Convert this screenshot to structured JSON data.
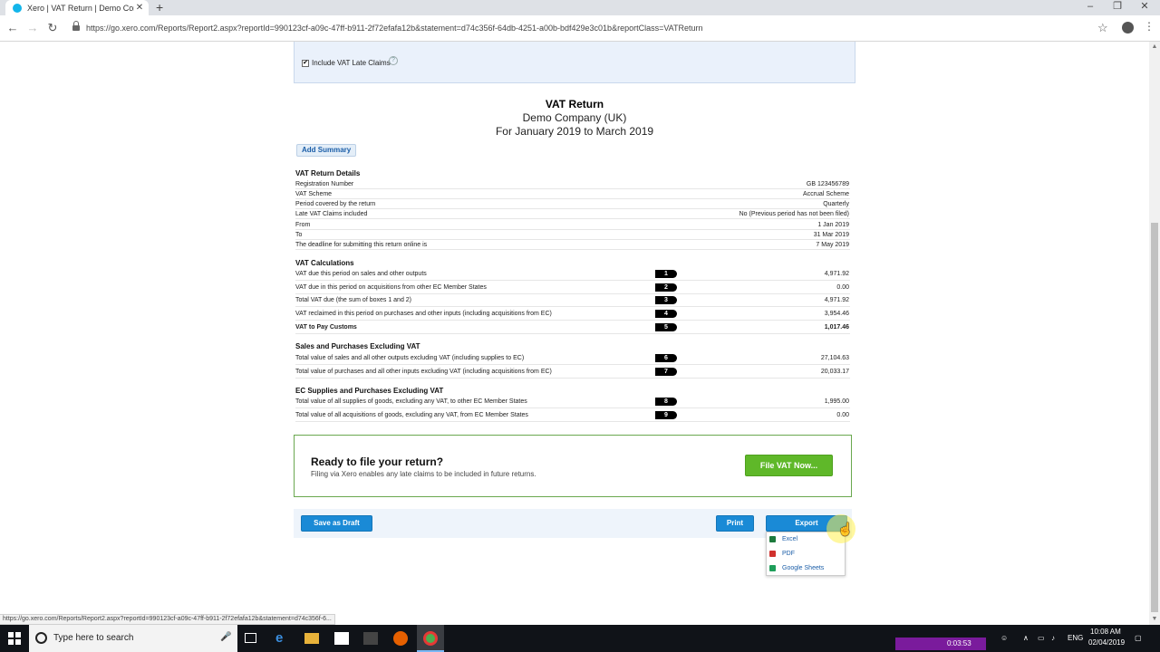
{
  "browser": {
    "tab_title": "Xero | VAT Return | Demo Compa",
    "new_tab": "+",
    "url": "https://go.xero.com/Reports/Report2.aspx?reportId=990123cf-a09c-47ff-b911-2f72efafa12b&statement=d74c356f-64db-4251-a00b-bdf429e3c01b&reportClass=VATReturn",
    "status_url": "https://go.xero.com/Reports/Report2.aspx?reportId=990123cf-a09c-47ff-b911-2f72efafa12b&statement=d74c356f-6..."
  },
  "options": {
    "include_late_claims_label": "Include VAT Late Claims",
    "include_late_claims_checked": true
  },
  "report": {
    "title": "VAT Return",
    "company": "Demo Company (UK)",
    "period": "For January 2019 to March 2019",
    "add_summary_label": "Add Summary"
  },
  "details": {
    "heading": "VAT Return Details",
    "rows": [
      {
        "label": "Registration Number",
        "value": "GB 123456789"
      },
      {
        "label": "VAT Scheme",
        "value": "Accrual Scheme"
      },
      {
        "label": "Period covered by the return",
        "value": "Quarterly"
      },
      {
        "label": "Late VAT Claims included",
        "value": "No (Previous period has not been filed)"
      },
      {
        "label": "From",
        "value": "1 Jan 2019"
      },
      {
        "label": "To",
        "value": "31 Mar 2019"
      },
      {
        "label": "The deadline for submitting this return online is",
        "value": "7 May 2019"
      }
    ]
  },
  "calculations": {
    "heading": "VAT Calculations",
    "rows": [
      {
        "label": "VAT due this period on sales and other outputs",
        "box": "1",
        "value": "4,971.92"
      },
      {
        "label": "VAT due in this period on acquisitions from other EC Member States",
        "box": "2",
        "value": "0.00"
      },
      {
        "label": "Total VAT due (the sum of boxes 1 and 2)",
        "box": "3",
        "value": "4,971.92"
      },
      {
        "label": "VAT reclaimed in this period on purchases and other inputs (including acquisitions from EC)",
        "box": "4",
        "value": "3,954.46"
      },
      {
        "label": "VAT to Pay Customs",
        "box": "5",
        "value": "1,017.46"
      }
    ]
  },
  "sales_purchases": {
    "heading": "Sales and Purchases Excluding VAT",
    "rows": [
      {
        "label": "Total value of sales and all other outputs excluding VAT (including supplies to EC)",
        "box": "6",
        "value": "27,104.63"
      },
      {
        "label": "Total value of purchases and all other inputs excluding VAT (including acquisitions from EC)",
        "box": "7",
        "value": "20,033.17"
      }
    ]
  },
  "ec_supplies": {
    "heading": "EC Supplies and Purchases Excluding VAT",
    "rows": [
      {
        "label": "Total value of all supplies of goods, excluding any VAT, to other EC Member States",
        "box": "8",
        "value": "1,995.00"
      },
      {
        "label": "Total value of all acquisitions of goods, excluding any VAT, from EC Member States",
        "box": "9",
        "value": "0.00"
      }
    ]
  },
  "ready": {
    "heading": "Ready to file your return?",
    "subtext": "Filing via Xero enables any late claims to be included in future returns.",
    "file_button": "File VAT Now..."
  },
  "actions": {
    "save_draft": "Save as Draft",
    "print": "Print",
    "export": "Export",
    "export_menu": [
      {
        "label": "Excel",
        "icon": "excel-icon",
        "color": "#1d7a3c"
      },
      {
        "label": "PDF",
        "icon": "pdf-icon",
        "color": "#d0312d"
      },
      {
        "label": "Google Sheets",
        "icon": "google-sheets-icon",
        "color": "#1e9e5a"
      }
    ]
  },
  "taskbar": {
    "search_placeholder": "Type here to search",
    "recording_time": "0:03:53",
    "language": "ENG",
    "time": "10:08 AM",
    "date": "02/04/2019"
  },
  "colors": {
    "xero_blue": "#13b5ea",
    "button_blue": "#1a8ad6",
    "file_green": "#5fb829",
    "panel_green_border": "#6aa84f"
  }
}
